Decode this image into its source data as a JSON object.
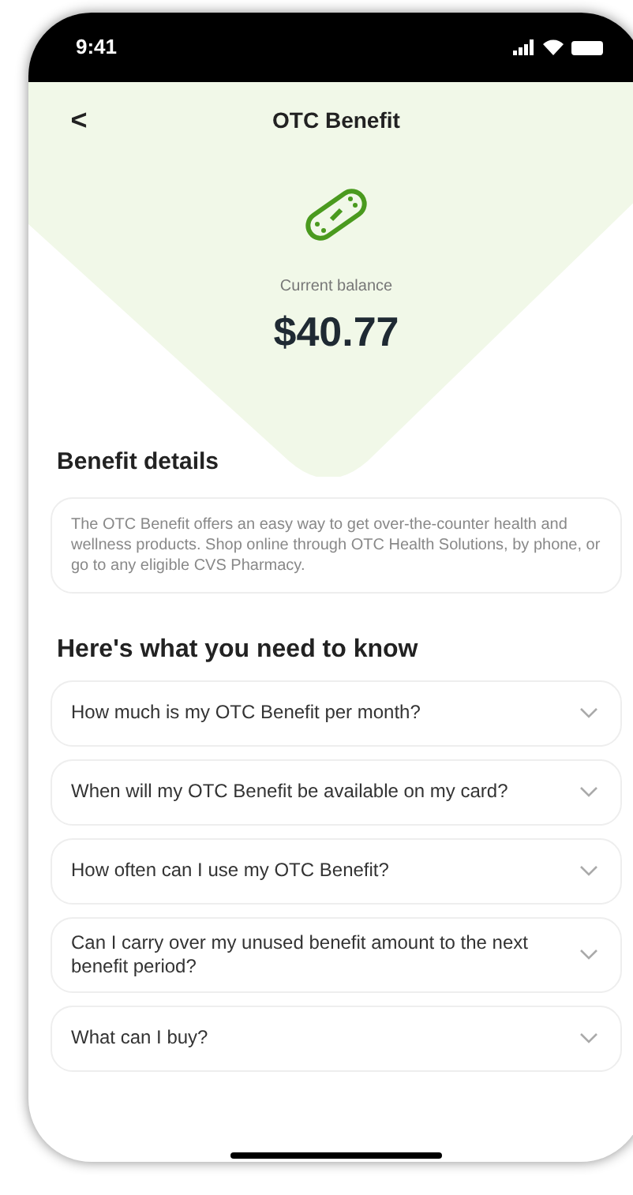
{
  "status_bar": {
    "time": "9:41"
  },
  "header": {
    "back": "<",
    "title": "OTC Benefit"
  },
  "balance": {
    "label": "Current balance",
    "amount": "$40.77"
  },
  "details": {
    "heading": "Benefit details",
    "text": "The OTC Benefit offers an easy way to get over-the-counter health and wellness products. Shop online through OTC Health Solutions, by phone, or go to any eligible CVS Pharmacy."
  },
  "faq": {
    "heading": "Here's what you need to know",
    "items": [
      {
        "question": "How much is my OTC Benefit per month?",
        "expanded": false
      },
      {
        "question": "When will my OTC Benefit be available on my card?",
        "expanded": false
      },
      {
        "question": "How often can I use my OTC Benefit?",
        "expanded": false
      },
      {
        "question": "Can I carry over my unused benefit amount to the next benefit period?",
        "expanded": false
      },
      {
        "question": "What can I buy?",
        "expanded": false
      }
    ]
  }
}
